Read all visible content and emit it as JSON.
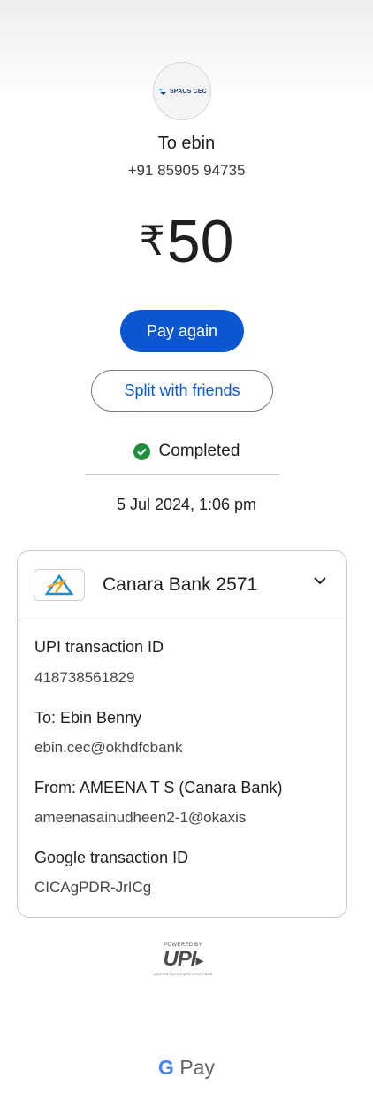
{
  "avatar": {
    "logo_text": "SPACS CEC"
  },
  "recipient": {
    "to_line": "To ebin",
    "phone": "+91 85905 94735"
  },
  "amount": {
    "currency_symbol": "₹",
    "value": "50"
  },
  "actions": {
    "pay_again": "Pay again",
    "split": "Split with friends"
  },
  "status": {
    "label": "Completed",
    "color": "#1e8e3e"
  },
  "timestamp": "5 Jul 2024, 1:06 pm",
  "details_card": {
    "bank_name": "Canara Bank 2571",
    "rows": [
      {
        "label": "UPI transaction ID",
        "value": "418738561829"
      },
      {
        "label": "To: Ebin  Benny",
        "value": "ebin.cec@okhdfcbank"
      },
      {
        "label": "From: AMEENA  T S (Canara Bank)",
        "value": "ameenasainudheen2-1@okaxis"
      },
      {
        "label": "Google transaction ID",
        "value": "CICAgPDR-JrICg"
      }
    ]
  },
  "footer": {
    "powered_by": "POWERED BY",
    "upi": "UPI",
    "upi_sub": "UNIFIED PAYMENTS INTERFACE",
    "gpay_g": "G",
    "gpay_text": "Pay"
  },
  "colors": {
    "primary": "#0b57d0",
    "success": "#1e8e3e"
  },
  "icons": [
    "spacs-logo-icon",
    "check-circle-icon",
    "canara-bank-logo-icon",
    "chevron-down-icon",
    "upi-logo-icon",
    "google-g-icon"
  ]
}
